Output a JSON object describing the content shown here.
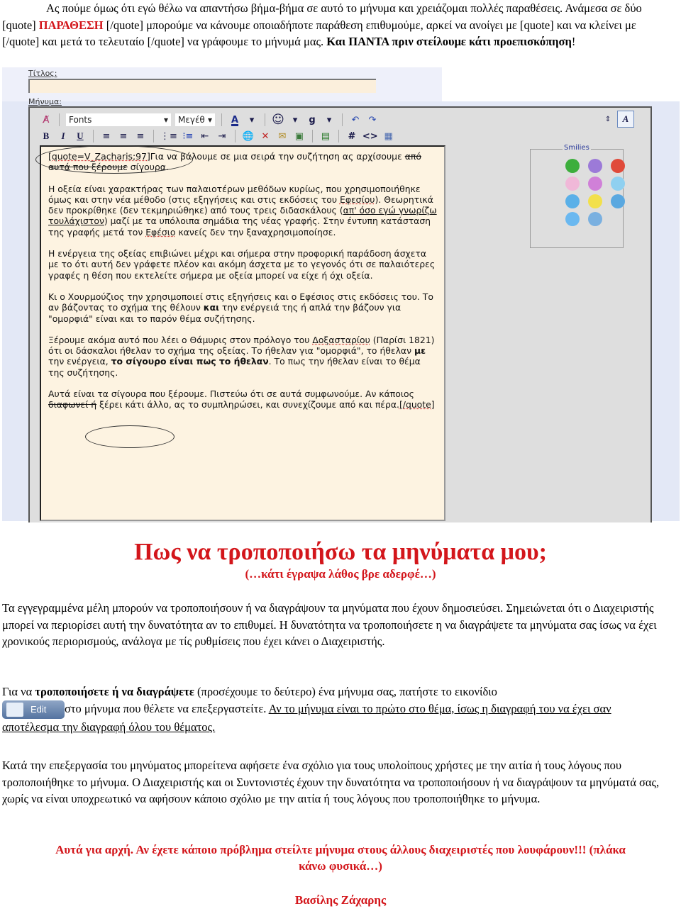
{
  "intro": {
    "line1": "Ας πούμε όμως ότι εγώ θέλω να απαντήσω βήμα-βήμα σε αυτό το μήνυμα και χρειάζομαι πολλές παραθέσεις. Ανάμεσα σε δύο  [quote] ",
    "highlight": "ΠΑΡΑΘΕΣΗ",
    "line2": " [/quote] μπορούμε να κάνουμε οποιαδήποτε παράθεση επιθυμούμε, αρκεί να ανοίγει με  [quote] και να κλείνει με  [/quote] και μετά το τελευταίο [/quote] να γράφουμε το μήνυμά μας. ",
    "bold": "Και ΠΑΝΤΑ πριν στείλουμε κάτι προεπισκόπηση",
    "end": "!"
  },
  "editor": {
    "title_label": "Τίτλος:",
    "title_value": "",
    "message_label": "Μήνυμα:",
    "toolbar": {
      "font_select": "Fonts",
      "size_select": "Μεγέθ",
      "row1_icons": [
        "remove-format-icon",
        "font-color-icon",
        "smiley-icon",
        "attach-icon",
        "undo-icon",
        "redo-icon"
      ],
      "row2_icons": [
        "bold-icon",
        "italic-icon",
        "underline-icon",
        "align-left-icon",
        "align-center-icon",
        "align-right-icon",
        "ordered-list-icon",
        "unordered-list-icon",
        "outdent-icon",
        "indent-icon",
        "link-icon",
        "unlink-icon",
        "email-icon",
        "image-icon",
        "quote-icon",
        "hash-icon",
        "code-icon",
        "php-icon"
      ]
    },
    "content": [
      {
        "text_a": "[quote=V_Zacharis;97]",
        "text_b": "Για να βάλουμε σε μια σειρά την συζήτηση ας αρχίσουμε ",
        "text_c": "από αυτά που ξέρουμε",
        "text_d": " σίγουρα."
      },
      {
        "p2_a": "Η οξεία είναι χαρακτήρας των παλαιοτέρων μεθόδων κυρίως, που χρησιμοποιήθηκε όμως και στην νέα μέθοδο (στις εξηγήσεις και στις εκδόσεις του ",
        "p2_link": "Εφεσίου",
        "p2_b": "). Θεωρητικά δεν προκρίθηκε (δεν τεκμηριώθηκε) από τους τρεις διδασκάλους (",
        "p2_u": "απ' όσο εγώ γνωρίζω τουλάχιστον",
        "p2_c": ") μαζί με τα υπόλοιπα σημάδια της νέας γραφής. Στην έντυπη κατάσταση της γραφής μετά τον ",
        "p2_link2": "Εφέσιο",
        "p2_d": " κανείς δεν την ξαναχρησιμοποίησε."
      },
      {
        "p3": "Η ενέργεια της οξείας επιβιώνει μέχρι και σήμερα στην προφορική παράδοση άσχετα με το ότι αυτή δεν γράφετε πλέον και ακόμη άσχετα με το γεγονός ότι σε παλαιότερες γραφές η θέση που εκτελείτε σήμερα με οξεία μπορεί να είχε ή όχι οξεία."
      },
      {
        "p4_a": "Κι ο Χουρμούζιος την χρησιμοποιεί στις εξηγήσεις και ο Εφέσιος στις εκδόσεις του. Το αν βάζοντας το σχήμα της θέλουν ",
        "p4_b": "και",
        "p4_c": " την ενέργειά της ή απλά την βάζουν για \"ομορφιά\" είναι και το παρόν θέμα συζήτησης."
      },
      {
        "p5_a": "Ξέρουμε ακόμα αυτό που λέει ο Θάμυρις στον πρόλογο του ",
        "p5_link": "Δοξασταρίου",
        "p5_b": " (Παρίσι 1821) ότι οι δάσκαλοι ήθελαν το σχήμα της οξείας. Το ήθελαν για \"ομορφιά\", το ήθελαν ",
        "p5_bold1": "με",
        "p5_c": " την ενέργεια, ",
        "p5_bold2": "το σίγουρο είναι πως το ήθελαν",
        "p5_d": ". Το πως την ήθελαν είναι το θέμα της συζήτησης."
      },
      {
        "p6_a": "Αυτά είναι τα σίγουρα που ξέρουμε. Πιστεύω ότι σε αυτά συμφωνούμε. Αν κάποιος ",
        "p6_strike": "διαφωνεί ή",
        "p6_b": " ξέρει κάτι άλλο, ας το συμπληρώσει, και συνεχίζουμε από και πέρα.",
        "p6_end": "[/quote]"
      }
    ],
    "smilies_label": "Smilies",
    "smilies": [
      {
        "name": "grin",
        "color": "#3cae3c",
        "glyph": "☻"
      },
      {
        "name": "sad",
        "color": "#9c7ad8",
        "glyph": "☹"
      },
      {
        "name": "angry",
        "color": "#e04a3a",
        "glyph": "☹"
      },
      {
        "name": "tongue",
        "color": "#f0b8d8",
        "glyph": "☺"
      },
      {
        "name": "smile-pink",
        "color": "#d080d8",
        "glyph": "☺"
      },
      {
        "name": "confused",
        "color": "#8fd0f0",
        "glyph": "?"
      },
      {
        "name": "wink",
        "color": "#5ab0e8",
        "glyph": "☺"
      },
      {
        "name": "happy",
        "color": "#f2e04a",
        "glyph": "☺"
      },
      {
        "name": "roll-eyes",
        "color": "#5aa8e0",
        "glyph": "☺"
      },
      {
        "name": "cool",
        "color": "#6ab8f0",
        "glyph": "😎"
      },
      {
        "name": "shocked",
        "color": "#7ab0e0",
        "glyph": "◉"
      }
    ]
  },
  "section": {
    "heading": "Πως να τροποποιήσω τα μηνύματα μου;",
    "subheading": "(…κάτι έγραψα λάθος βρε αδερφέ…)",
    "p1": "Τα εγγεγραμμένα μέλη μπορούν να τροποποιήσουν ή να διαγράψουν τα μηνύματα που έχουν δημοσιεύσει. Σημειώνεται ότι ο Διαχειριστής μπορεί να περιορίσει αυτή την δυνατότητα αν το επιθυμεί. Η δυνατότητα να τροποποιήσετε η να διαγράψετε τα μηνύματα σας ίσως να έχει χρονικούς περιορισμούς, ανάλογα με τίς ρυθμίσεις που έχει κάνει ο Διαχειριστής.",
    "p2_a": "Για να ",
    "p2_bold": "τροποποιήσετε ή να διαγράψετε",
    "p2_b": " (προσέχουμε το δεύτερο) ένα μήνυμα σας, πατήστε το εικονίδιο ",
    "edit_button": "Edit",
    "p2_c": "στο μήνυμα που θέλετε να επεξεργαστείτε. ",
    "p2_underline": "Αν το μήνυμα είναι το πρώτο στο θέμα, ίσως η διαγραφή του να έχει σαν αποτέλεσμα την διαγραφή όλου του θέματος.",
    "p3": "Κατά την επεξεργασία του μηνύματος μπορείτενα αφήσετε ένα σχόλιο για τους υπολοίπους χρήστες με την αιτία ή τους λόγους που τροποποιήθηκε το μήνυμα. Ο Διαχειριστής και οι Συντονιστές έχουν την δυνατότητα να τροποποιήσουν ή να διαγράψουν τα μηνύματά σας, χωρίς να είναι υποχρεωτικό να αφήσουν κάποιο σχόλιο με την αιτία ή τους λόγους που τροποποιήθηκε το μήνυμα.",
    "closing": "Αυτά για αρχή. Αν έχετε κάποιο πρόβλημα στείλτε μήνυμα στους άλλους διαχειριστές που λουφάρουν!!! (πλάκα κάνω φυσικά…)",
    "signature": "Βασίλης Ζάχαρης"
  }
}
